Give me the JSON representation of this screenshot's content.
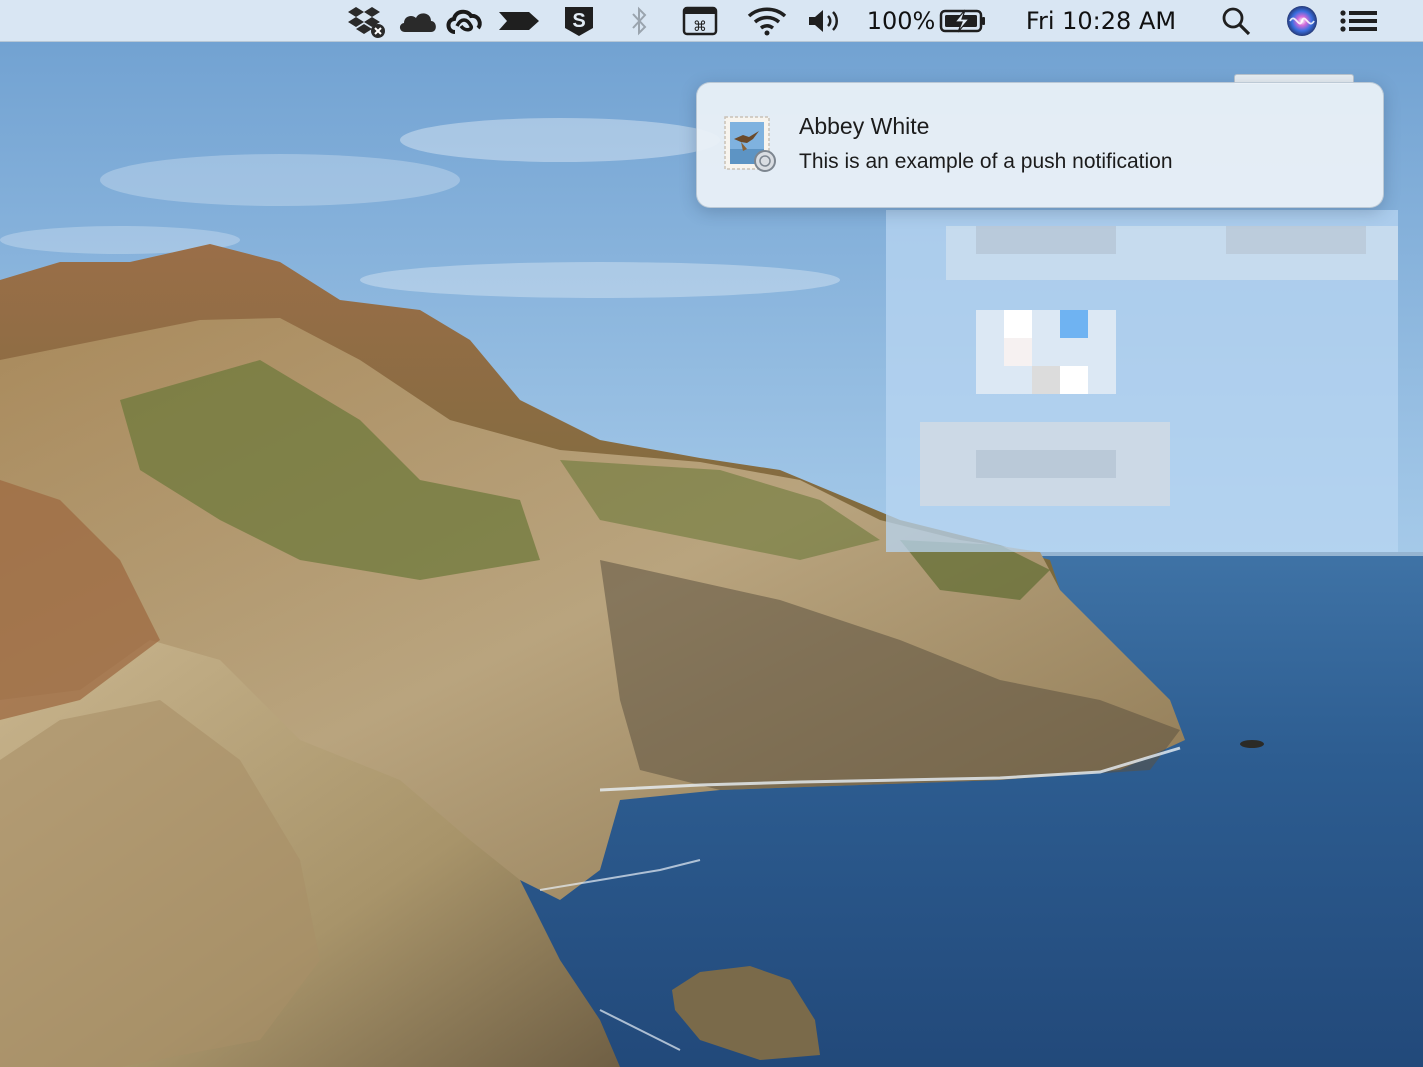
{
  "menubar": {
    "status_icons": [
      "dropbox-icon",
      "onedrive-icon",
      "creative-cloud-icon",
      "migration-arrow-icon",
      "s-app-icon",
      "bluetooth-icon",
      "keyboard-viewer-icon",
      "wifi-icon",
      "volume-icon"
    ],
    "battery_percent": "100%",
    "battery_icon": "battery-charging-icon",
    "clock": "Fri 10:28 AM",
    "right_icons": [
      "spotlight-search-icon",
      "siri-icon",
      "notification-center-icon"
    ]
  },
  "notification": {
    "app_icon": "mail-stamp-icon",
    "title": "Abbey White",
    "body": "This is an example of a push notification"
  },
  "colors": {
    "sky": "#a9cde9",
    "sea": "#2a5a8f",
    "menubar": "#e2ecf5",
    "notification_bg": "#ecf2f7",
    "text": "#1c1c1c"
  }
}
